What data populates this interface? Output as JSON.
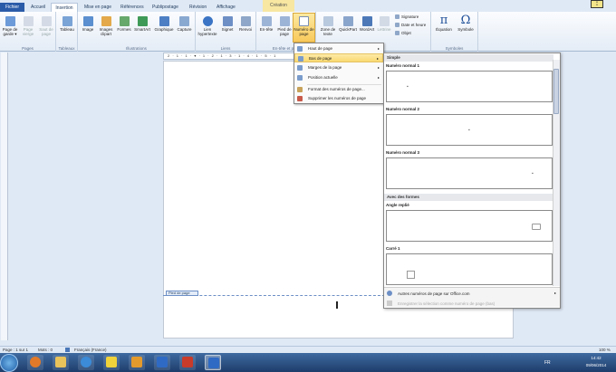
{
  "tabs": [
    "Fichier",
    "Accueil",
    "Insertion",
    "Mise en page",
    "Références",
    "Publipostage",
    "Révision",
    "Affichage"
  ],
  "contextual": "Création",
  "groups": {
    "pages": {
      "label": "Pages",
      "items": [
        "Page de garde ▾",
        "Page vierge",
        "Saut de page"
      ]
    },
    "tableau": {
      "label": "Tableaux",
      "items": [
        "Tableau"
      ]
    },
    "illustrations": {
      "label": "Illustrations",
      "items": [
        "Image",
        "Images clipart",
        "Formes",
        "SmartArt",
        "Graphique",
        "Capture"
      ]
    },
    "liens": {
      "label": "Liens",
      "items": [
        "Lien hypertexte",
        "Signet",
        "Renvoi"
      ]
    },
    "entete": {
      "label": "En-tête et pied",
      "items": [
        "En-tête",
        "Pied de page",
        "Numéro de page"
      ]
    },
    "texte": {
      "label": "Texte",
      "items": [
        "Zone de texte",
        "QuickPart",
        "WordArt",
        "Lettrine"
      ],
      "small": [
        "Signature",
        "Date et heure",
        "Objet"
      ]
    },
    "symboles": {
      "label": "Symboles",
      "items": [
        "Équation",
        "Symbole"
      ]
    }
  },
  "menu": {
    "items": [
      "Haut de page",
      "Bas de page",
      "Marges de la page",
      "Position actuelle",
      "Format des numéros de page...",
      "Supprimer les numéros de page"
    ],
    "highlighted": 1
  },
  "gallery": {
    "sections": [
      "Simple",
      "Avec des formes"
    ],
    "entries": [
      "Numéro normal 1",
      "Numéro normal 2",
      "Numéro normal 3",
      "Angle replié",
      "Carré 1"
    ],
    "bottom": [
      "Autres numéros de page sur Office.com",
      "Enregistrer la sélection comme numéro de page (bas)"
    ]
  },
  "ruler": "2 · 1 · 1 · ▾ · 1 · 2 · 1 · 3 · 1 · 4 · 1 · 5 · 1",
  "footer_tag": "Pied de page",
  "status": {
    "page": "Page : 1 sur 1",
    "words": "Mots : 0",
    "language": "Français (France)",
    "zoom": "100 %"
  },
  "taskbar": {
    "lang": "FR",
    "time": "14:42",
    "date": "09/06/2014"
  },
  "colors": {
    "accent": "#2a5ba8",
    "highlight": "#f9d971",
    "contextual": "#f7e7a1"
  }
}
